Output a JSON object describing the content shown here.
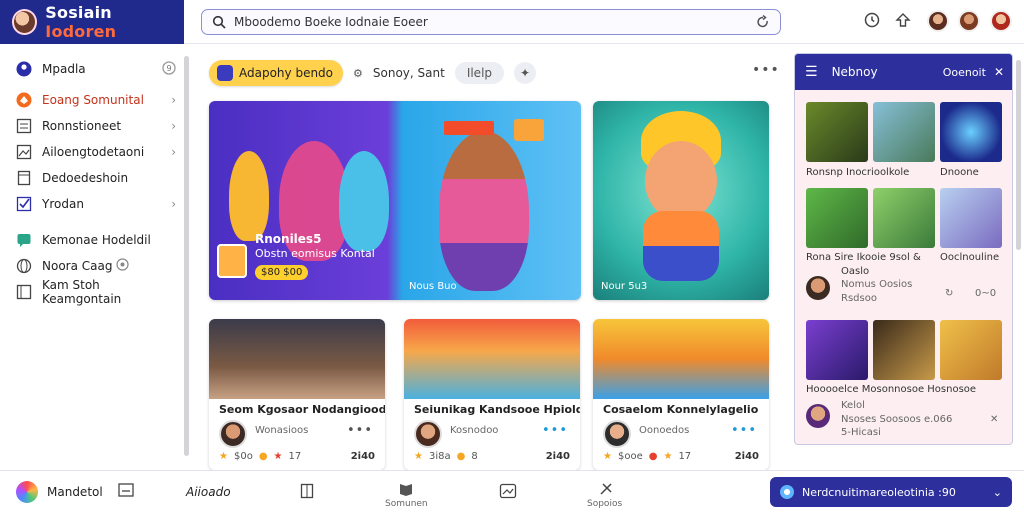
{
  "header": {
    "brand_main": "Sosiain",
    "brand_accent": "Iodoren",
    "search_value": "Mboodemo Boeke Iodnaie Eoeer"
  },
  "sidebar": {
    "items": [
      {
        "label": "Mpadla",
        "icon": "profile-icon",
        "chevron": false,
        "badge": true
      },
      {
        "label": "Eoang Somunital",
        "icon": "community-icon",
        "chevron": true
      },
      {
        "label": "Ronnstioneet",
        "icon": "list-icon",
        "chevron": true
      },
      {
        "label": "Ailoengtodetaoni",
        "icon": "image-icon",
        "chevron": true
      },
      {
        "label": "Dedoedeshoin",
        "icon": "document-icon",
        "chevron": false
      },
      {
        "label": "Yrodan",
        "icon": "check-icon",
        "chevron": true
      },
      {
        "label": "Kemonae Hodeldil",
        "icon": "chat-icon",
        "chevron": false
      },
      {
        "label": "Noora Caag",
        "icon": "globe-icon",
        "chevron": false,
        "badge": true
      },
      {
        "label": "Kam Stoh Keamgontain",
        "icon": "library-icon",
        "chevron": false
      }
    ]
  },
  "filters": {
    "primary": "Adapohy bendo",
    "plain": "Sonoy,  Sant",
    "pill": "Ilelp"
  },
  "hero": {
    "main": {
      "title": "Rnoniles5",
      "subtitle": "Obstn eomisus Kontal",
      "price": "$80 $00",
      "tag": "Nous Buo"
    },
    "side": {
      "tag": "Nour 5u3"
    }
  },
  "cards": [
    {
      "title": "Seom  Kgosaor  Nodangioodon",
      "sub": "Wonasioos",
      "likes": "$0o",
      "score": "17",
      "time": "2i40"
    },
    {
      "title": "Seiunikag  Kandsooe  Hpioldan",
      "sub": "Kosnodoo",
      "likes": "3i8a",
      "score": "8",
      "time": "2i40"
    },
    {
      "title": "Cosaelom  Konnelylagelio",
      "sub": "Oonoedos",
      "likes": "$ooe",
      "score": "17",
      "time": "2i40"
    }
  ],
  "right_panel": {
    "title": "Nebnoy",
    "link": "Ooenoit",
    "row1_label": "Ronsnp Inocrioolkole",
    "row1_right": "Dnoone",
    "row2_label_a": "Rona Sire Ikooie 9sol &",
    "row2_label_b": "Ooclnouline",
    "row2_sub": "Oaslo",
    "row2_meta_a": "Nomus Oosios",
    "row2_meta_b": "Rsdsoo",
    "row2_right": "0~0",
    "row3_label": "Hooooelce Mosonnosoe Hosnosoe",
    "row3_meta_a": "Kelol",
    "row3_meta_b": "Nsoses  Soosoos  e.066",
    "row3_meta_c": "5-Hicasi"
  },
  "bottom": {
    "brand": "Mandetol",
    "item1": "Aiioado",
    "cap1": "Somunen",
    "cap2": "Sopoios",
    "notify": "Nerdcnuitimareoleotinia :90"
  }
}
